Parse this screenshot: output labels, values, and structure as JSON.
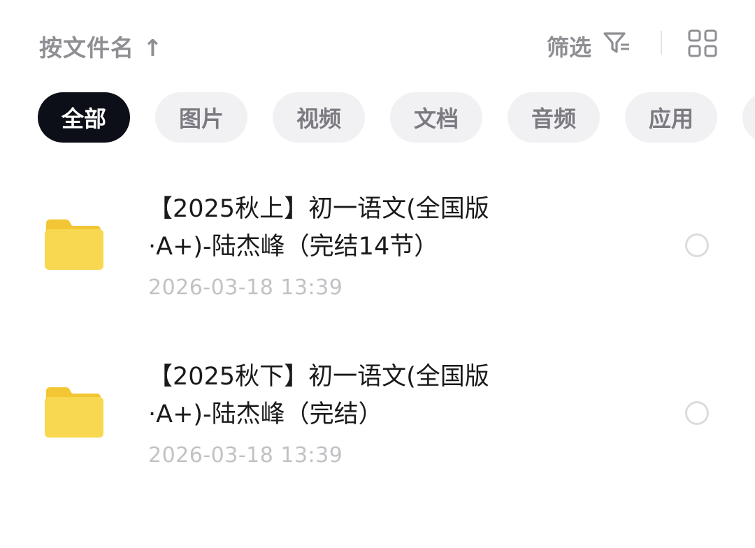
{
  "toolbar": {
    "sort_label": "按文件名 ↑",
    "filter_label": "筛选",
    "filter_icon": "filter-icon",
    "view_icon": "grid-view-icon"
  },
  "categories": [
    {
      "label": "全部",
      "active": true
    },
    {
      "label": "图片",
      "active": false
    },
    {
      "label": "视频",
      "active": false
    },
    {
      "label": "文档",
      "active": false
    },
    {
      "label": "音频",
      "active": false
    },
    {
      "label": "应用",
      "active": false
    }
  ],
  "files": [
    {
      "name_line1": "【2025秋上】初一语文(全国版",
      "name_line2": "·A+)-陆杰峰（完结14节）",
      "date": "2026-03-18  13:39",
      "icon": "folder-icon",
      "selected": false
    },
    {
      "name_line1": "【2025秋下】初一语文(全国版",
      "name_line2": "·A+)-陆杰峰（完结）",
      "date": "2026-03-18  13:39",
      "icon": "folder-icon",
      "selected": false
    }
  ],
  "colors": {
    "active_chip": "#0c0f18",
    "chip_bg": "#f1f1f4",
    "folder": "#f7d54a",
    "text_secondary": "#8e8e93"
  }
}
